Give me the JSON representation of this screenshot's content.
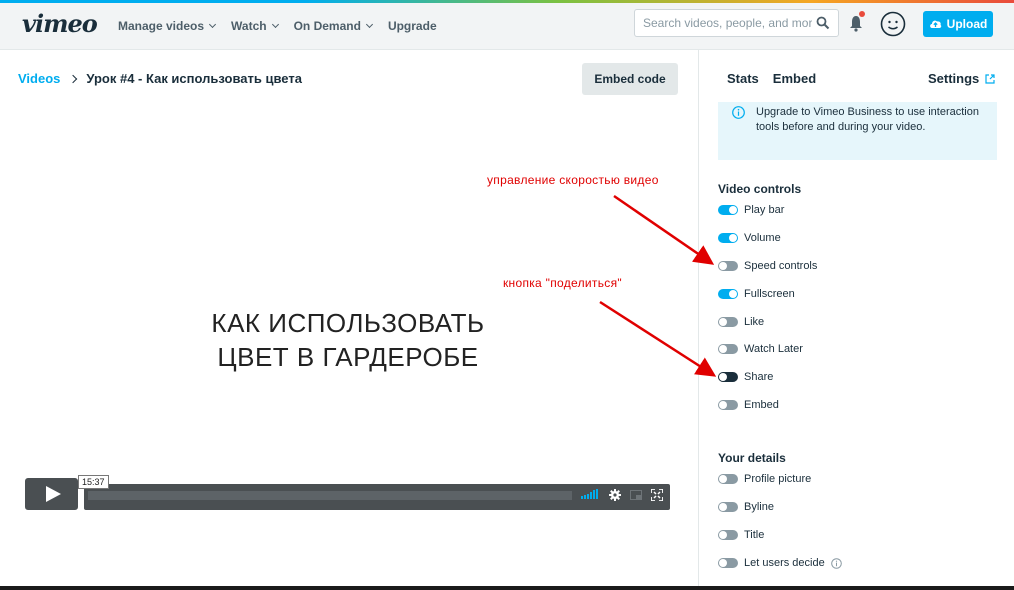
{
  "brand": {
    "logo": "vimeo"
  },
  "nav": {
    "items": [
      {
        "label": "Manage videos",
        "has_dropdown": true
      },
      {
        "label": "Watch",
        "has_dropdown": true
      },
      {
        "label": "On Demand",
        "has_dropdown": true
      },
      {
        "label": "Upgrade",
        "has_dropdown": false
      }
    ]
  },
  "search": {
    "placeholder": "Search videos, people, and more"
  },
  "header_actions": {
    "upload_label": "Upload",
    "icons": [
      "search-icon",
      "bell-icon",
      "avatar-icon",
      "upload-cloud-icon"
    ]
  },
  "breadcrumb": {
    "root": "Videos",
    "current": "Урок #4 - Как использовать цвета"
  },
  "embed_code_label": "Embed code",
  "video": {
    "title_line1": "КАК ИСПОЛЬЗОВАТЬ",
    "title_line2": "ЦВЕТ В ГАРДЕРОБЕ",
    "time": "15:37"
  },
  "annotations": {
    "speed": "управление скоростью видео",
    "share": "кнопка \"поделиться\""
  },
  "sidebar": {
    "tabs": [
      "Stats",
      "Embed"
    ],
    "settings_label": "Settings",
    "info_text": "Upgrade to Vimeo Business to use interaction tools before and during your video.",
    "video_controls_heading": "Video controls",
    "video_controls": [
      {
        "label": "Play bar",
        "state": "on"
      },
      {
        "label": "Volume",
        "state": "on"
      },
      {
        "label": "Speed controls",
        "state": "off"
      },
      {
        "label": "Fullscreen",
        "state": "on"
      },
      {
        "label": "Like",
        "state": "off"
      },
      {
        "label": "Watch Later",
        "state": "off"
      },
      {
        "label": "Share",
        "state": "dark"
      },
      {
        "label": "Embed",
        "state": "off"
      }
    ],
    "your_details_heading": "Your details",
    "your_details": [
      {
        "label": "Profile picture",
        "state": "off"
      },
      {
        "label": "Byline",
        "state": "off"
      },
      {
        "label": "Title",
        "state": "off"
      },
      {
        "label": "Let users decide",
        "state": "off"
      }
    ]
  },
  "colors": {
    "accent": "#00adef",
    "text": "#1a2e3b",
    "annotation": "#e00000"
  }
}
